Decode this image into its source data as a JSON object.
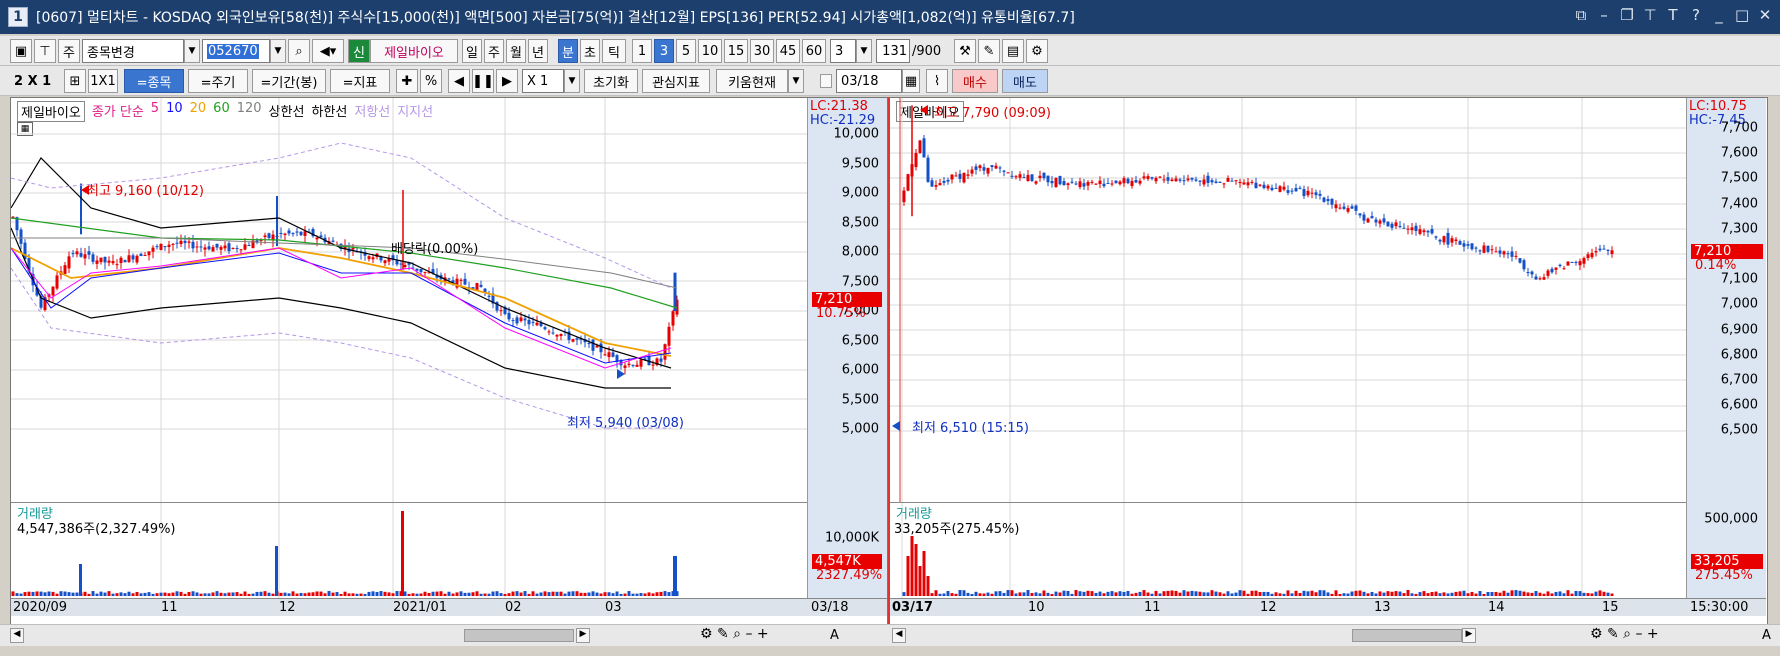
{
  "title": {
    "num": "1",
    "text": "[0607] 멀티차트 - KOSDAQ 외국인보유[58(천)] 주식수[15,000(천)] 액면[500] 자본금[75(억)] 결산[12월] EPS[136] PER[52.94] 시가총액[1,082(억)] 유통비율[67.7]"
  },
  "toolbar1": {
    "period_sel": "주",
    "stock_change": "종목변경",
    "code": "052670",
    "badge_new": "신",
    "stock_name": "제일바이오",
    "periods": [
      "일",
      "주",
      "월",
      "년",
      "분",
      "초",
      "틱"
    ],
    "minutes": [
      "1",
      "3",
      "5",
      "10",
      "15",
      "30",
      "45",
      "60"
    ],
    "count": "3",
    "bars": "131",
    "bars_total": "/900"
  },
  "toolbar2": {
    "layout": "2 X 1",
    "layout2": "1X1",
    "tabs": [
      "=종목",
      "=주기",
      "=기간(봉)",
      "=지표"
    ],
    "zoom": "X 1",
    "reset": "초기화",
    "watch": "관심지표",
    "kiwoom": "키움현재",
    "date": "03/18",
    "buy": "매수",
    "sell": "매도"
  },
  "left": {
    "legend": {
      "name": "제일바이오",
      "ma_label": "종가 단순",
      "ma": [
        "5",
        "10",
        "20",
        "60",
        "120"
      ],
      "upper": "상한선",
      "lower": "하한선",
      "resist": "저항선",
      "support": "지지선"
    },
    "lc": "LC:21.38",
    "hc": "HC:-21.29",
    "yticks": [
      "10,000",
      "9,500",
      "9,000",
      "8,500",
      "8,000",
      "7,500",
      "7,000",
      "6,500",
      "6,000",
      "5,500",
      "5,000"
    ],
    "price_tag": "7,210",
    "pct": "10.75%",
    "high_ann": "최고 9,160 (10/12)",
    "low_ann": "최저 5,940 (03/08)",
    "event": "배당락(0.00%)",
    "vol_title": "거래량",
    "vol_value": "4,547,386주(2,327.49%)",
    "vol_tick": "10,000K",
    "vol_tag": "4,547K",
    "vol_pct": "2327.49%",
    "xticks": [
      "2020/09",
      "11",
      "12",
      "2021/01",
      "02",
      "03",
      "03/18"
    ]
  },
  "right": {
    "legend": {
      "name": "제일바이오"
    },
    "lc": "LC:10.75",
    "hc": "HC:-7.45",
    "yticks": [
      "7,700",
      "7,600",
      "7,500",
      "7,400",
      "7,300",
      "7,200",
      "7,100",
      "7,000",
      "6,900",
      "6,800",
      "6,700",
      "6,600",
      "6,500"
    ],
    "price_tag": "7,210",
    "pct": "0.14%",
    "high_ann": "최고 7,790 (09:09)",
    "low_ann": "최저 6,510 (15:15)",
    "vol_title": "거래량",
    "vol_value": "33,205주(275.45%)",
    "vol_tick": "500,000",
    "vol_tag": "33,205",
    "vol_pct": "275.45%",
    "xticks": [
      "03/17",
      "10",
      "11",
      "12",
      "13",
      "14",
      "15",
      "15:30:00"
    ]
  },
  "colors": {
    "up": "#e60000",
    "down": "#1450c8",
    "ma5": "#ff00ff",
    "ma10": "#1010ff",
    "ma20": "#f0a000",
    "ma60": "#20a020",
    "ma120": "#808080",
    "band": "#000000",
    "env": "#b497e8"
  }
}
